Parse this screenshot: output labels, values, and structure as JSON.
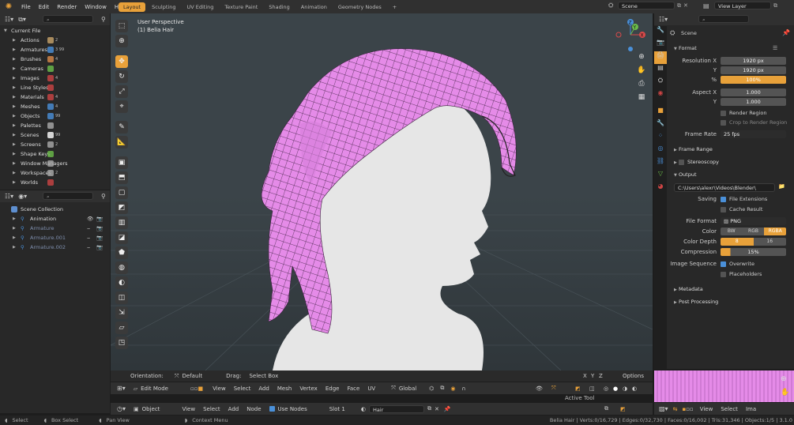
{
  "topbar": {
    "menus": [
      "File",
      "Edit",
      "Render",
      "Window",
      "Help"
    ],
    "workspaces": [
      "Layout",
      "Sculpting",
      "UV Editing",
      "Texture Paint",
      "Shading",
      "Animation",
      "Geometry Nodes"
    ],
    "add_tab": "+",
    "scene": "Scene",
    "view_layer": "View Layer"
  },
  "outliner_top": {
    "root": "Current File",
    "items": [
      {
        "label": "Actions",
        "badge": "2"
      },
      {
        "label": "Armatures",
        "badge": "3 99"
      },
      {
        "label": "Brushes",
        "badge": "4"
      },
      {
        "label": "Cameras",
        "badge": ""
      },
      {
        "label": "Images",
        "badge": "4"
      },
      {
        "label": "Line Styles",
        "badge": ""
      },
      {
        "label": "Materials",
        "badge": "4"
      },
      {
        "label": "Meshes",
        "badge": "4"
      },
      {
        "label": "Objects",
        "badge": "99"
      },
      {
        "label": "Palettes",
        "badge": ""
      },
      {
        "label": "Scenes",
        "badge": "99"
      },
      {
        "label": "Screens",
        "badge": "2"
      },
      {
        "label": "Shape Keys",
        "badge": ""
      },
      {
        "label": "Window Managers",
        "badge": ""
      },
      {
        "label": "Workspaces",
        "badge": "2"
      },
      {
        "label": "Worlds",
        "badge": ""
      }
    ]
  },
  "outliner_bottom": {
    "root": "Scene Collection",
    "items": [
      {
        "label": "Animation"
      },
      {
        "label": "Armature"
      },
      {
        "label": "Armature.001"
      },
      {
        "label": "Armature.002"
      }
    ]
  },
  "viewport": {
    "perspective": "User Perspective",
    "object": "(1) Belia Hair",
    "orientation_label": "Orientation:",
    "orientation_value": "Default",
    "drag_label": "Drag:",
    "drag_value": "Select Box",
    "axes": [
      "X",
      "Y",
      "Z"
    ],
    "options": "Options",
    "mode": "Edit Mode",
    "menus": [
      "View",
      "Select",
      "Add",
      "Mesh",
      "Vertex",
      "Edge",
      "Face",
      "UV"
    ],
    "transform": "Global",
    "gizmo_x": "X",
    "gizmo_y": "Y",
    "gizmo_z": "Z"
  },
  "node_header": {
    "type": "Object",
    "menus": [
      "View",
      "Select",
      "Add",
      "Node"
    ],
    "use_nodes": "Use Nodes",
    "slot": "Slot 1",
    "material": "Hair",
    "active_tool": "Active Tool"
  },
  "image_header": {
    "menus": [
      "View",
      "Select",
      "Ima"
    ]
  },
  "properties": {
    "scene": "Scene",
    "format_title": "Format",
    "res_x_label": "Resolution X",
    "res_x": "1920 px",
    "res_y_label": "Y",
    "res_y": "1920 px",
    "percent_label": "%",
    "percent": "100%",
    "aspect_x_label": "Aspect X",
    "aspect_x": "1.000",
    "aspect_y_label": "Y",
    "aspect_y": "1.000",
    "render_region": "Render Region",
    "crop_region": "Crop to Render Region",
    "frame_rate_label": "Frame Rate",
    "frame_rate": "25 fps",
    "frame_range": "Frame Range",
    "stereoscopy": "Stereoscopy",
    "output_title": "Output",
    "output_path": "C:\\Users\\alexr\\Videos\\Blender\\",
    "saving_label": "Saving",
    "file_extensions": "File Extensions",
    "cache_result": "Cache Result",
    "file_format_label": "File Format",
    "file_format": "PNG",
    "color_label": "Color",
    "color_options": [
      "BW",
      "RGB",
      "RGBA"
    ],
    "color_depth_label": "Color Depth",
    "color_depth_options": [
      "8",
      "16"
    ],
    "compression_label": "Compression",
    "compression": "15%",
    "image_sequence_label": "Image Sequence",
    "overwrite": "Overwrite",
    "placeholders": "Placeholders",
    "metadata": "Metadata",
    "post_processing": "Post Processing"
  },
  "statusbar": {
    "select": "Select",
    "box_select": "Box Select",
    "pan_view": "Pan View",
    "context_menu": "Context Menu",
    "stats": "Belia Hair | Verts:0/16,729 | Edges:0/32,730 | Faces:0/16,002 | Tris:31,346 | Objects:1/5 | 3.1.0"
  },
  "colors": {
    "accent": "#e8a13a",
    "hair": "#e58be8",
    "viewport_bg": "#3b4449"
  }
}
